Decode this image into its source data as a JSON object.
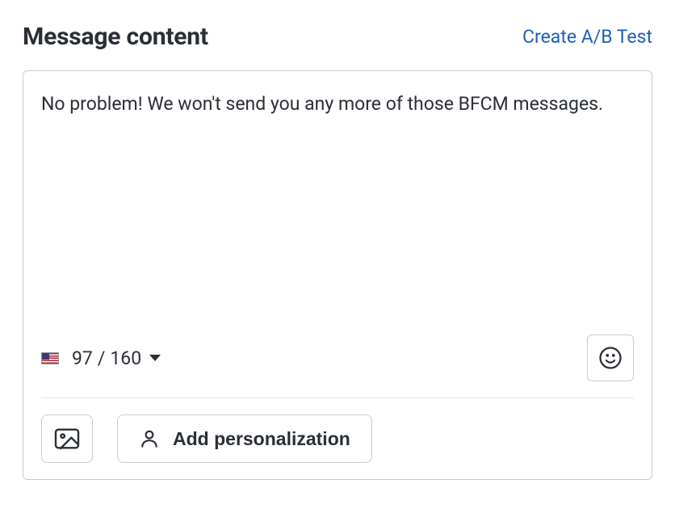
{
  "header": {
    "title": "Message content",
    "ab_link": "Create A/B Test"
  },
  "editor": {
    "text": "No problem! We won't send you any more of those BFCM messages.",
    "char_count": "97",
    "char_limit": "160",
    "flag": "us"
  },
  "actions": {
    "personalize_label": "Add personalization"
  }
}
